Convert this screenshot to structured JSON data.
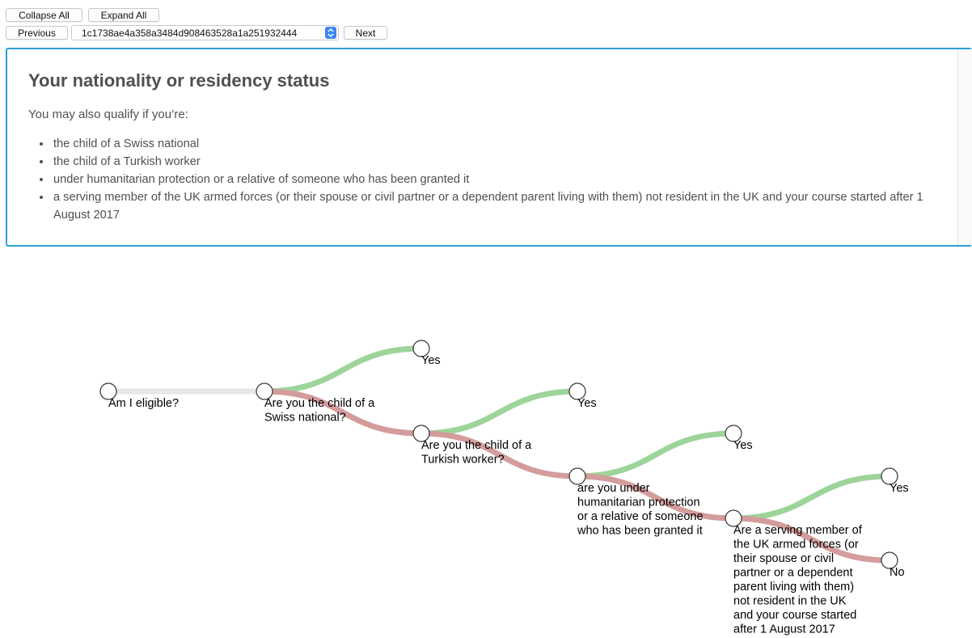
{
  "toolbar": {
    "collapse_all_label": "Collapse All",
    "expand_all_label": "Expand All",
    "previous_label": "Previous",
    "next_label": "Next",
    "selected_id": "1c1738ae4a358a3484d908463528a1a251932444"
  },
  "panel": {
    "title": "Your nationality or residency status",
    "intro": "You may also qualify if you’re:",
    "items": [
      "the child of a Swiss national",
      "the child of a Turkish worker",
      "under humanitarian protection or a relative of someone who has been granted it",
      "a serving member of the UK armed forces (or their spouse or civil partner or a dependent parent living with them) not resident in the UK and your course started after 1 August 2017"
    ]
  },
  "tree": {
    "colors": {
      "yes": "#9dd49a",
      "no": "#d49c9c",
      "root_link": "#e6e6e6",
      "node_stroke": "#333333"
    },
    "nodes": [
      {
        "id": "root",
        "lines": [
          "Am I eligible?"
        ]
      },
      {
        "id": "q1",
        "lines": [
          "Are you the child of a",
          "Swiss national?"
        ]
      },
      {
        "id": "q1-yes",
        "lines": [
          "Yes"
        ]
      },
      {
        "id": "q2",
        "lines": [
          "Are you the child of a",
          "Turkish worker?"
        ]
      },
      {
        "id": "q2-yes",
        "lines": [
          "Yes"
        ]
      },
      {
        "id": "q3",
        "lines": [
          "are you under",
          "humanitarian protection",
          "or a relative of someone",
          "who has been granted it"
        ]
      },
      {
        "id": "q3-yes",
        "lines": [
          "Yes"
        ]
      },
      {
        "id": "q4",
        "lines": [
          "Are a serving member of",
          "the UK armed forces (or",
          "their spouse or civil",
          "partner or a dependent",
          "parent living with them)",
          "not resident in the UK",
          "and your course started",
          "after 1 August 2017"
        ]
      },
      {
        "id": "q4-yes",
        "lines": [
          "Yes"
        ]
      },
      {
        "id": "q4-no",
        "lines": [
          "No"
        ]
      }
    ],
    "links": [
      {
        "from": "root",
        "to": "q1",
        "kind": "root"
      },
      {
        "from": "q1",
        "to": "q1-yes",
        "kind": "yes"
      },
      {
        "from": "q1",
        "to": "q2",
        "kind": "no"
      },
      {
        "from": "q2",
        "to": "q2-yes",
        "kind": "yes"
      },
      {
        "from": "q2",
        "to": "q3",
        "kind": "no"
      },
      {
        "from": "q3",
        "to": "q3-yes",
        "kind": "yes"
      },
      {
        "from": "q3",
        "to": "q4",
        "kind": "no"
      },
      {
        "from": "q4",
        "to": "q4-yes",
        "kind": "yes"
      },
      {
        "from": "q4",
        "to": "q4-no",
        "kind": "no"
      }
    ]
  }
}
